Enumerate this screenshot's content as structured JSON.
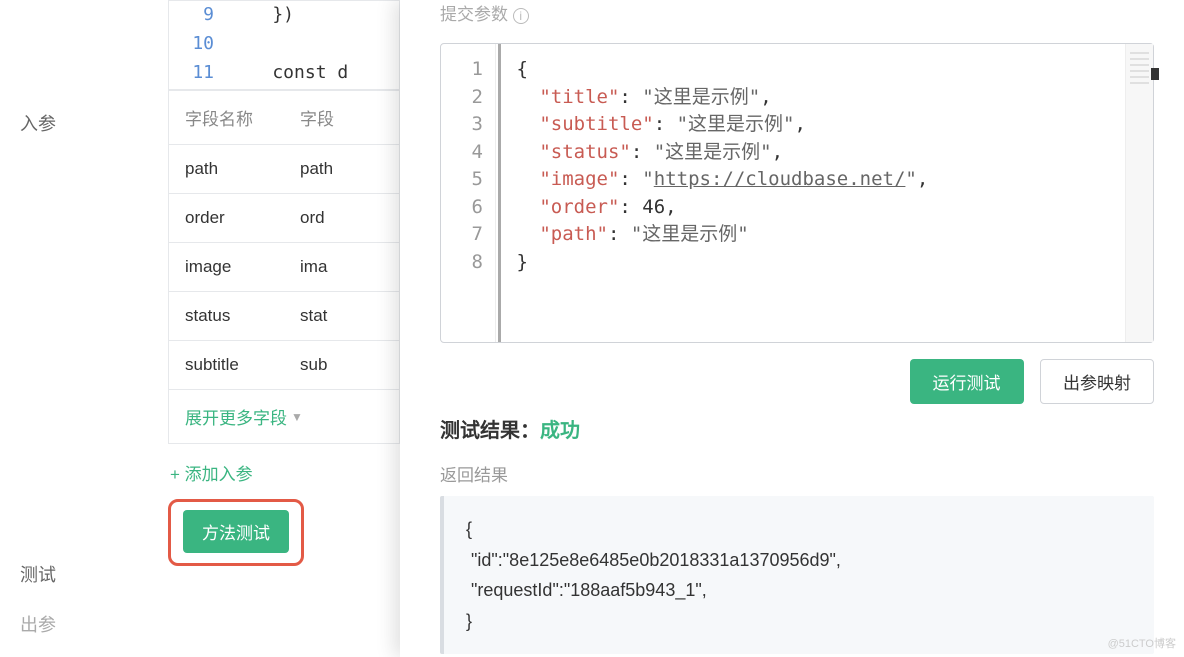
{
  "left": {
    "in_label": "入参",
    "test_label": "测试",
    "out_label": "出参"
  },
  "code_preview": {
    "lines": [
      "9",
      "10",
      "11"
    ],
    "content": [
      "    })",
      "",
      "    const d"
    ]
  },
  "param_table": {
    "header_name": "字段名称",
    "header_type": "字段",
    "rows": [
      {
        "name": "path",
        "type": "path"
      },
      {
        "name": "order",
        "type": "ord"
      },
      {
        "name": "image",
        "type": "ima"
      },
      {
        "name": "status",
        "type": "stat"
      },
      {
        "name": "subtitle",
        "type": "sub"
      }
    ],
    "expand_label": "展开更多字段",
    "add_label": "+ 添加入参",
    "method_test_btn": "方法测试"
  },
  "panel": {
    "title_prefix": "提交参数",
    "json_lines": [
      "1",
      "2",
      "3",
      "4",
      "5",
      "6",
      "7",
      "8"
    ],
    "json_body": {
      "title": "这里是示例",
      "subtitle": "这里是示例",
      "status": "这里是示例",
      "image": "https://cloudbase.net/",
      "order": 46,
      "path": "这里是示例"
    },
    "run_btn": "运行测试",
    "map_btn": "出参映射",
    "result_label": "测试结果：",
    "result_status": "成功",
    "return_label": "返回结果",
    "return_body": "{\n \"id\":\"8e125e8e6485e0b2018331a1370956d9\",\n \"requestId\":\"188aaf5b943_1\",\n}"
  },
  "watermark": "@51CTO博客"
}
